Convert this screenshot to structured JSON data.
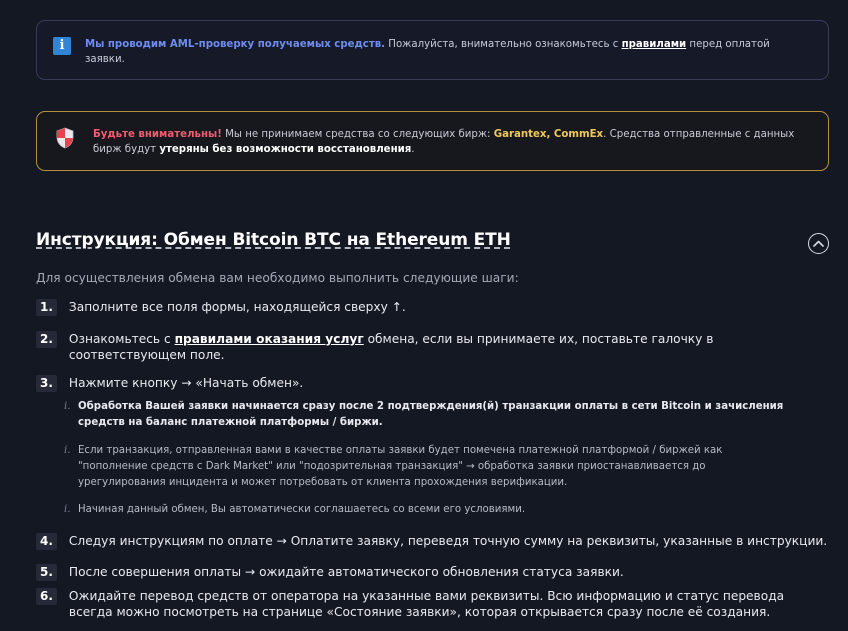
{
  "aml_notice": {
    "highlight": "Мы проводим AML-проверку получаемых средств.",
    "text_before_link": " Пожалуйста, внимательно ознакомьтесь с ",
    "link": "правилами",
    "text_after_link": " перед оплатой заявки."
  },
  "warning_notice": {
    "alert": "Будьте внимательны!",
    "text1": " Мы не принимаем средства со следующих бирж: ",
    "exchanges": "Garantex, CommEx",
    "text2": ". Средства отправленные с данных бирж будут ",
    "bold": "утеряны без возможности восстановления",
    "text3": "."
  },
  "instructions": {
    "title": "Инструкция: Обмен Bitcoin BTC на Ethereum ETH",
    "intro": "Для осуществления обмена вам необходимо выполнить следующие шаги:",
    "steps": [
      {
        "num": "1.",
        "text": "Заполните все поля формы, находящейся сверху ↑."
      },
      {
        "num": "2.",
        "text_before": "Ознакомьтесь с ",
        "link": "правилами оказания услуг",
        "text_after": " обмена, если вы принимаете их, поставьте галочку в соответствующем поле."
      },
      {
        "num": "3.",
        "text": "Нажмите кнопку → «Начать обмен»."
      },
      {
        "num": "4.",
        "text": "Следуя инструкциям по оплате → Оплатите заявку, переведя точную сумму на реквизиты, указанные в инструкции."
      },
      {
        "num": "5.",
        "text": "После совершения оплаты → ожидайте автоматического обновления статуса заявки."
      },
      {
        "num": "6.",
        "text": "Ожидайте перевод средств от оператора на указанные вами реквизиты. Всю информацию и статус перевода всегда можно посмотреть на странице «Состояние заявки», которая открывается сразу после её создания."
      }
    ],
    "substeps": [
      {
        "mark": "i.",
        "text": "Обработка Вашей заявки начинается сразу после 2 подтверждения(й) транзакции оплаты в сети Bitcoin и зачисления средств на баланс платежной платформы / биржи."
      },
      {
        "mark": "i.",
        "text": "Если транзакция, отправленная вами в качестве оплаты заявки будет помечена платежной платформой / биржей как \"пополнение средств с Dark Market\" или \"подозрительная транзакция\" → обработка заявки приостанавливается до урегулирования инцидента и может потребовать от клиента прохождения верификации."
      },
      {
        "mark": "i.",
        "text": "Начиная данный обмен, Вы автоматически соглашаетесь со всеми его условиями."
      }
    ]
  },
  "colors": {
    "background": "#141823",
    "aml_accent": "#6f8cf0",
    "warning_border": "#b58f3f",
    "warning_alert": "#ef5c70",
    "warning_gold": "#f0c95a"
  },
  "icons": {
    "aml": "info-icon",
    "warning": "shield-icon",
    "collapse": "chevron-up-icon"
  }
}
